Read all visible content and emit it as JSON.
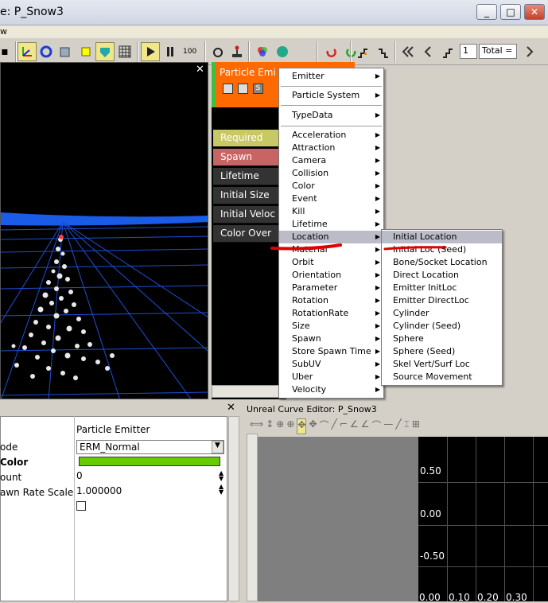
{
  "window": {
    "title": "e: P_Snow3",
    "menu_view": "w"
  },
  "toolbar": {
    "playback_rate": "100",
    "frame_value": "1",
    "total_label": "Total ="
  },
  "emitter": {
    "title": "Particle Emi",
    "modules": [
      "Required",
      "Spawn",
      "Lifetime",
      "Initial Size",
      "Initial Veloc",
      "Color Over"
    ]
  },
  "context_menu": {
    "items": [
      "Emitter",
      "Particle System",
      "TypeData",
      "Acceleration",
      "Attraction",
      "Camera",
      "Collision",
      "Color",
      "Event",
      "Kill",
      "Lifetime",
      "Location",
      "Material",
      "Orbit",
      "Orientation",
      "Parameter",
      "Rotation",
      "RotationRate",
      "Size",
      "Spawn",
      "Store Spawn Time",
      "SubUV",
      "Uber",
      "Velocity"
    ],
    "selected": "Location"
  },
  "submenu": {
    "items": [
      "Initial Location",
      "Initial Loc (Seed)",
      "Bone/Socket Location",
      "Direct Location",
      "Emitter InitLoc",
      "Emitter DirectLoc",
      "Cylinder",
      "Cylinder (Seed)",
      "Sphere",
      "Sphere (Seed)",
      "Skel Vert/Surf Loc",
      "Source Movement"
    ],
    "selected": "Initial Location"
  },
  "properties": {
    "header": "Particle Emitter",
    "rows": [
      {
        "name": "ode",
        "value": "ERM_Normal"
      },
      {
        "name": "Color",
        "value": ""
      },
      {
        "name": "ount",
        "value": "0"
      },
      {
        "name": "awn Rate Scale",
        "value": "1.000000"
      }
    ],
    "color_swatch": "#66cc00"
  },
  "curve_editor": {
    "title": "Unreal Curve Editor: P_Snow3",
    "y_labels": [
      "0.50",
      "0.00",
      "-0.50"
    ],
    "x_labels": [
      "0.00",
      "0.10",
      "0.20",
      "0.30"
    ]
  },
  "colors": {
    "emitter_header": "#ff6a00",
    "required": "#c8c864",
    "spawn": "#c86464",
    "annotation": "#e00000"
  }
}
